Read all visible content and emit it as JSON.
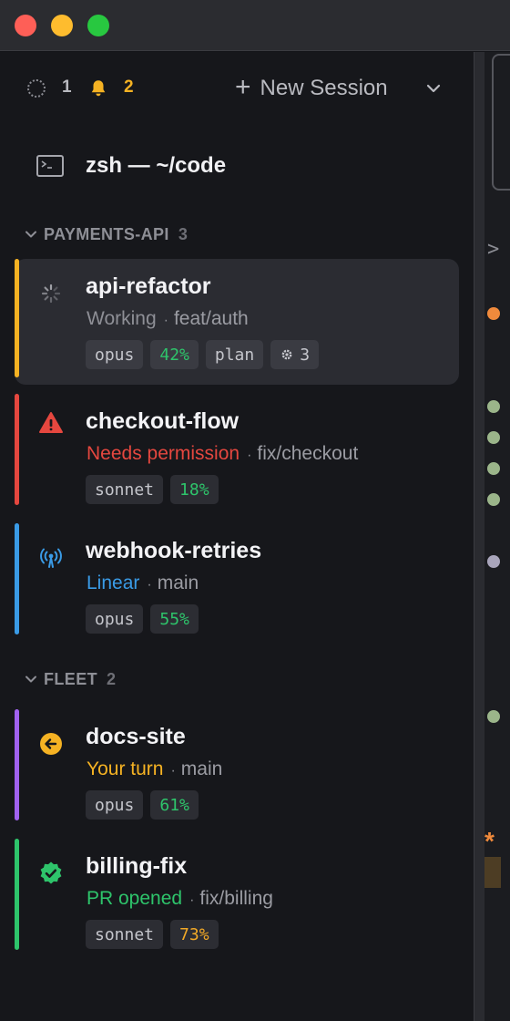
{
  "window": {
    "traffic_lights": [
      "close",
      "minimize",
      "zoom"
    ]
  },
  "topbar": {
    "running_count": "1",
    "notification_count": "2",
    "new_session_label": "New Session"
  },
  "terminal": {
    "title": "zsh — ~/code"
  },
  "groups": [
    {
      "name": "PAYMENTS-API",
      "count": "3",
      "sessions": [
        {
          "name": "api-refactor",
          "status": "Working",
          "status_color": "#8e8f96",
          "branch": "feat/auth",
          "accent": "#f5b223",
          "icon": "spinner-icon",
          "selected": true,
          "chips": [
            {
              "text": "opus",
              "kind": "model"
            },
            {
              "text": "42%",
              "kind": "green"
            },
            {
              "text": "plan",
              "kind": "mode"
            },
            {
              "text": "3",
              "kind": "gear"
            }
          ]
        },
        {
          "name": "checkout-flow",
          "status": "Needs permission",
          "status_color": "#e5473f",
          "branch": "fix/checkout",
          "accent": "#e5473f",
          "icon": "warning-icon",
          "chips": [
            {
              "text": "sonnet",
              "kind": "model"
            },
            {
              "text": "18%",
              "kind": "green"
            }
          ]
        },
        {
          "name": "webhook-retries",
          "status": "Linear",
          "status_color": "#3a9be6",
          "branch": "main",
          "accent": "#3a9be6",
          "icon": "broadcast-icon",
          "chips": [
            {
              "text": "opus",
              "kind": "model"
            },
            {
              "text": "55%",
              "kind": "green"
            }
          ]
        }
      ]
    },
    {
      "name": "FLEET",
      "count": "2",
      "sessions": [
        {
          "name": "docs-site",
          "status": "Your turn",
          "status_color": "#f5b223",
          "branch": "main",
          "accent": "#a162f0",
          "icon": "arrow-left-circle-icon",
          "chips": [
            {
              "text": "opus",
              "kind": "model"
            },
            {
              "text": "61%",
              "kind": "green"
            }
          ]
        },
        {
          "name": "billing-fix",
          "status": "PR opened",
          "status_color": "#2ec46b",
          "branch": "fix/billing",
          "accent": "#2ec46b",
          "icon": "verified-check-icon",
          "chips": [
            {
              "text": "sonnet",
              "kind": "model"
            },
            {
              "text": "73%",
              "kind": "amber"
            }
          ]
        }
      ]
    }
  ],
  "right_pane": {
    "prompt_glyph": ">",
    "star_glyph": "*"
  }
}
